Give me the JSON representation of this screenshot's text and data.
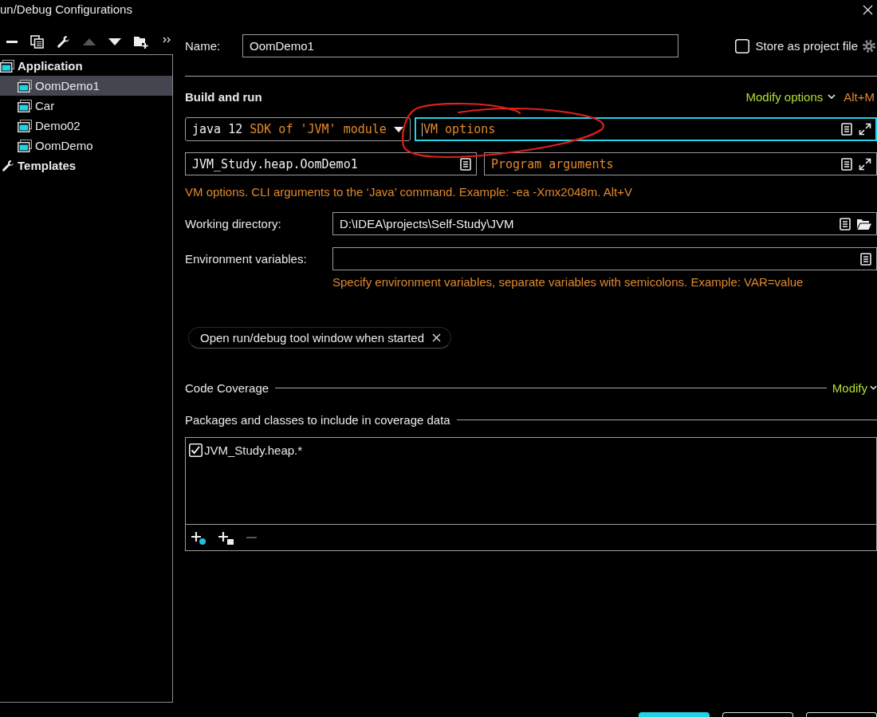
{
  "window": {
    "title": "un/Debug Configurations"
  },
  "toolbar": [
    {
      "kind": "remove",
      "disabled": false
    },
    {
      "kind": "copy",
      "disabled": false
    },
    {
      "kind": "edit",
      "disabled": false
    },
    {
      "kind": "move_up",
      "disabled": true
    },
    {
      "kind": "move_down",
      "disabled": false
    },
    {
      "kind": "new_folder",
      "disabled": false
    },
    {
      "kind": "more",
      "disabled": false
    }
  ],
  "tree": [
    {
      "label": "Application",
      "kind": "application",
      "selected": false,
      "children": [
        {
          "label": "OomDemo1",
          "kind": "config",
          "selected": true
        },
        {
          "label": "Car",
          "kind": "config",
          "selected": false
        },
        {
          "label": "Demo02",
          "kind": "config",
          "selected": false
        },
        {
          "label": "OomDemo",
          "kind": "config",
          "selected": false
        }
      ]
    },
    {
      "label": "Templates",
      "kind": "templates",
      "selected": false
    }
  ],
  "name": {
    "label": "Name:",
    "value": "OomDemo1"
  },
  "store_as_project_file": {
    "label": "Store as project file",
    "checked": false
  },
  "build_and_run": {
    "title": "Build and run",
    "modify_options": "Modify options",
    "shortcut": "Alt+M",
    "jre": {
      "value": "java 12",
      "detail": "SDK of 'JVM' module"
    },
    "vm_options": {
      "placeholder": "VM options",
      "focused": true
    },
    "main_class": {
      "value": "JVM_Study.heap.OomDemo1"
    },
    "program_arguments": {
      "placeholder": "Program arguments"
    },
    "hint": "VM options. CLI arguments to the ‘Java’ command. Example: -ea -Xmx2048m. Alt+V"
  },
  "working_directory": {
    "label": "Working directory:",
    "value": "D:\\IDEA\\projects\\Self-Study\\JVM"
  },
  "environment_variables": {
    "label": "Environment variables:",
    "hint": "Specify environment variables, separate variables with semicolons. Example: VAR=value"
  },
  "options": [
    {
      "label": "Open run/debug tool window when started"
    }
  ],
  "code_coverage": {
    "title": "Code Coverage",
    "modify": "Modify",
    "packages_title": "Packages and classes to include in coverage data",
    "patterns": [
      {
        "label": "JVM_Study.heap.*",
        "checked": true
      }
    ],
    "toolbar": [
      {
        "kind": "add_class",
        "disabled": false
      },
      {
        "kind": "add_package",
        "disabled": false
      },
      {
        "kind": "remove",
        "disabled": true
      }
    ]
  },
  "dialog_buttons": [
    {
      "kind": "primary"
    },
    {
      "kind": "secondary"
    },
    {
      "kind": "secondary"
    }
  ]
}
